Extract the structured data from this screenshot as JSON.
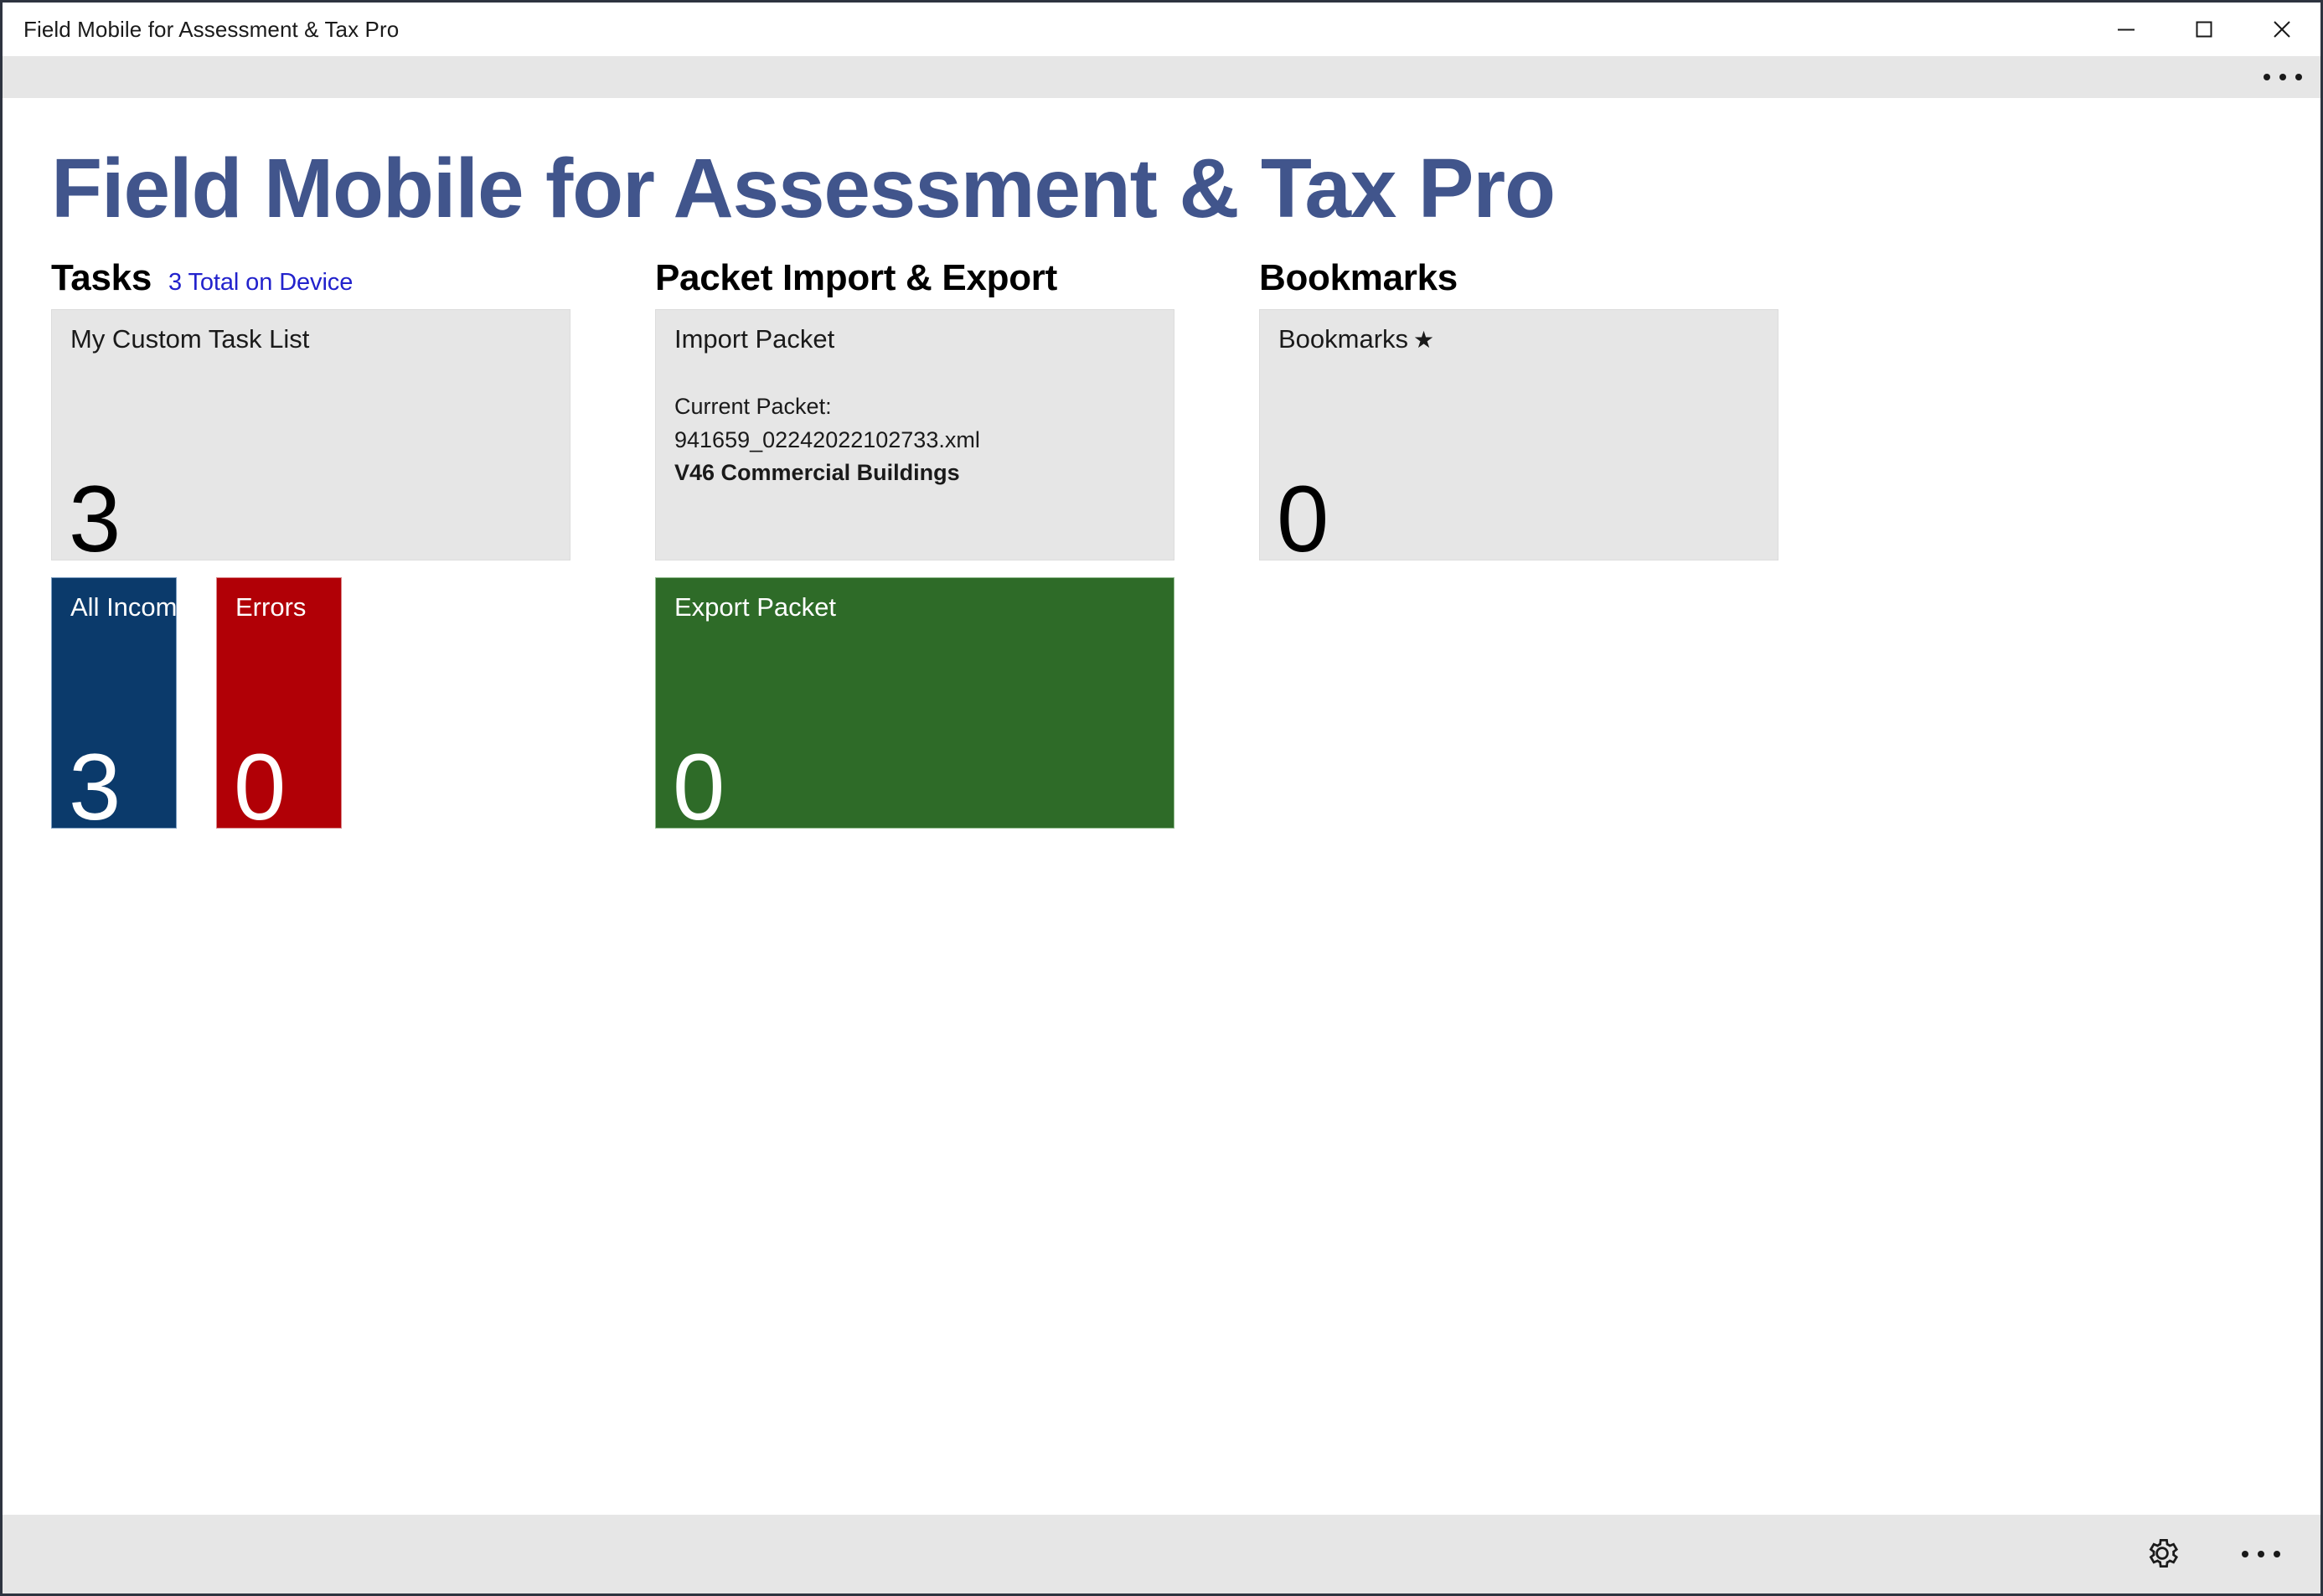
{
  "window": {
    "title": "Field Mobile for Assessment & Tax Pro",
    "minimize_label": "Minimize",
    "maximize_label": "Maximize",
    "close_label": "Close"
  },
  "top_bar": {
    "more_label": "See more"
  },
  "page": {
    "heading": "Field Mobile for Assessment & Tax Pro",
    "accent_color": "#41558C",
    "link_color": "#2222CC"
  },
  "sections": {
    "tasks": {
      "title": "Tasks",
      "subtitle": "3 Total on Device",
      "custom_list": {
        "label": "My Custom Task List",
        "count": "3",
        "color": "#E6E6E6"
      },
      "all_incomplete": {
        "label": "All Incomplete",
        "count": "3",
        "color": "#0B3A6B"
      },
      "errors": {
        "label": "Errors",
        "count": "0",
        "color": "#B10006"
      }
    },
    "packet": {
      "title": "Packet Import & Export",
      "import": {
        "label": "Import Packet",
        "current_packet_label": "Current Packet:",
        "current_packet_file": "941659_02242022102733.xml",
        "current_packet_name": "V46 Commercial Buildings",
        "color": "#E6E6E6"
      },
      "export": {
        "label": "Export Packet",
        "count": "0",
        "color": "#2E6B28"
      }
    },
    "bookmarks": {
      "title": "Bookmarks",
      "tile": {
        "label": "Bookmarks",
        "star": "★",
        "count": "0",
        "color": "#E6E6E6"
      }
    }
  },
  "bottom_bar": {
    "settings_label": "Settings",
    "more_label": "See more"
  }
}
